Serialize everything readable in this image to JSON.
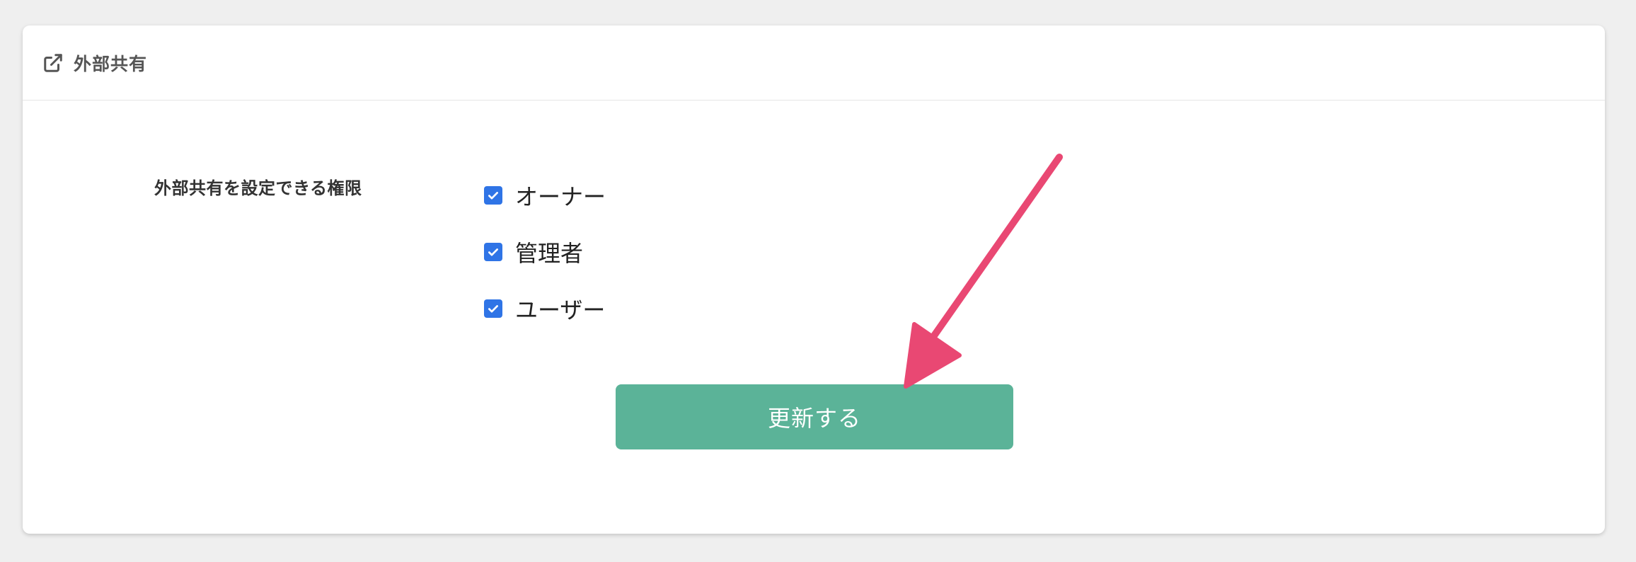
{
  "section": {
    "title": "外部共有",
    "icon": "external-link-icon"
  },
  "form": {
    "field_label": "外部共有を設定できる権限",
    "options": [
      {
        "label": "オーナー",
        "checked": true
      },
      {
        "label": "管理者",
        "checked": true
      },
      {
        "label": "ユーザー",
        "checked": true
      }
    ],
    "submit_label": "更新する"
  },
  "colors": {
    "background": "#efefef",
    "card": "#ffffff",
    "checkbox": "#2f74e6",
    "button": "#5bb398",
    "annotation_arrow": "#e94873"
  }
}
